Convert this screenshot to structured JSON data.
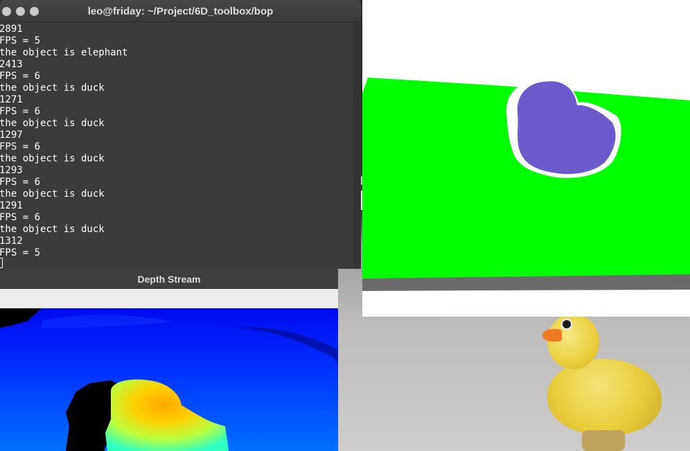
{
  "terminal": {
    "title": "leo@friday: ~/Project/6D_toolbox/bop",
    "lines": [
      "2891",
      "FPS = 5",
      "the object is elephant",
      "2413",
      "FPS = 6",
      "the object is duck",
      "1271",
      "FPS = 6",
      "the object is duck",
      "1297",
      "FPS = 6",
      "the object is duck",
      "1293",
      "FPS = 6",
      "the object is duck",
      "1291",
      "FPS = 6",
      "the object is duck",
      "1312",
      "FPS = 5"
    ]
  },
  "depth_window": {
    "title": "Depth Stream"
  },
  "colors": {
    "terminal_bg": "#3b3b3b",
    "titlebar": "#3e3e3e",
    "segmentation_background": "#00ff00",
    "segmentation_object": "#6a5acd",
    "depth_far": "#0000e0",
    "depth_near": "#ffb000"
  },
  "icons": {
    "close": "close-icon",
    "minimize": "minimize-icon",
    "maximize": "maximize-icon"
  }
}
